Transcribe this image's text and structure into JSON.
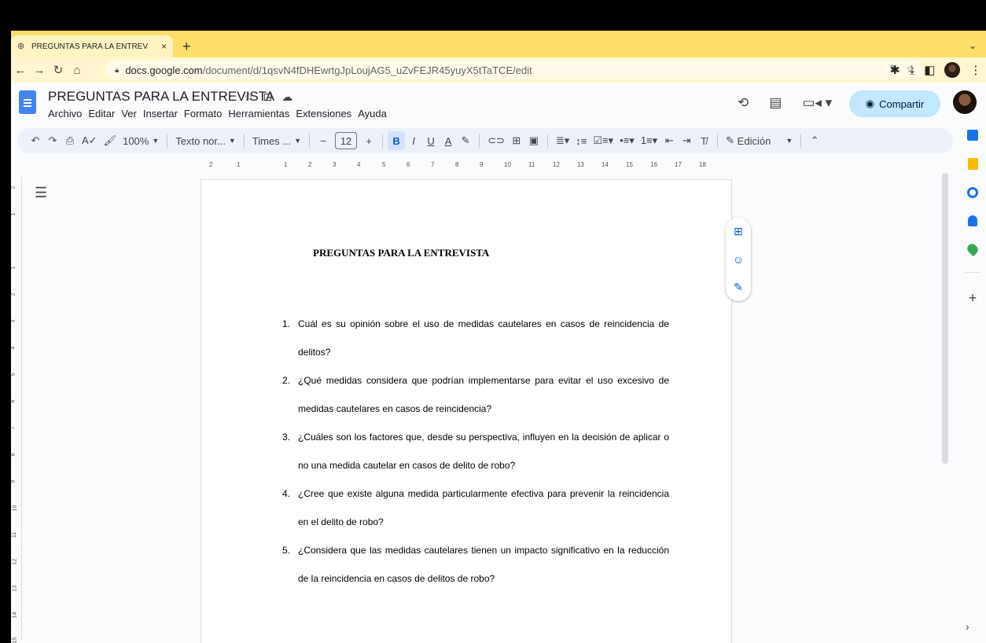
{
  "browser": {
    "tab_title": "PREGUNTAS PARA LA ENTREV",
    "tab_close": "×",
    "new_tab": "+",
    "tab_menu": "⌄",
    "url_host": "docs.google.com",
    "url_path": "/document/d/1qsvN4fDHEwrtgJpLoujAG5_uZvFEJR45yuyX5tTaTCE/edit"
  },
  "docs": {
    "title": "PREGUNTAS PARA LA ENTREVISTA",
    "menu": [
      "Archivo",
      "Editar",
      "Ver",
      "Insertar",
      "Formato",
      "Herramientas",
      "Extensiones",
      "Ayuda"
    ],
    "share_label": "Compartir",
    "toolbar": {
      "zoom": "100%",
      "style": "Texto nor...",
      "font": "Times ...",
      "font_size": "12",
      "mode": "Edición"
    },
    "ruler_numbers": [
      "2",
      "1",
      "1",
      "2",
      "3",
      "4",
      "5",
      "6",
      "7",
      "8",
      "9",
      "10",
      "11",
      "12",
      "13",
      "14",
      "15",
      "16",
      "17",
      "18"
    ],
    "vruler_numbers": [
      "2",
      "1",
      "1",
      "2",
      "3",
      "4",
      "5",
      "6",
      "7",
      "8",
      "9",
      "10",
      "11",
      "12",
      "13",
      "14",
      "15"
    ]
  },
  "document": {
    "heading": "PREGUNTAS PARA LA ENTREVISTA",
    "questions": [
      {
        "num": "1.",
        "text": "Cuál es su opinión sobre el uso de medidas cautelares en casos de reincidencia de delitos?"
      },
      {
        "num": "2.",
        "text": "¿Qué medidas considera que podrían implementarse para evitar el uso excesivo de medidas cautelares en casos de reincidencia?"
      },
      {
        "num": "3.",
        "text": "¿Cuáles son los factores que, desde su perspectiva, influyen en la decisión de aplicar o no una medida cautelar en casos de delito de robo?"
      },
      {
        "num": "4.",
        "text": "¿Cree que existe alguna medida particularmente efectiva para prevenir la reincidencia en el delito de robo?"
      },
      {
        "num": "5.",
        "text": "¿Considera que las medidas cautelares tienen un impacto significativo en la reducción de la reincidencia en casos de delitos de robo?"
      }
    ]
  }
}
